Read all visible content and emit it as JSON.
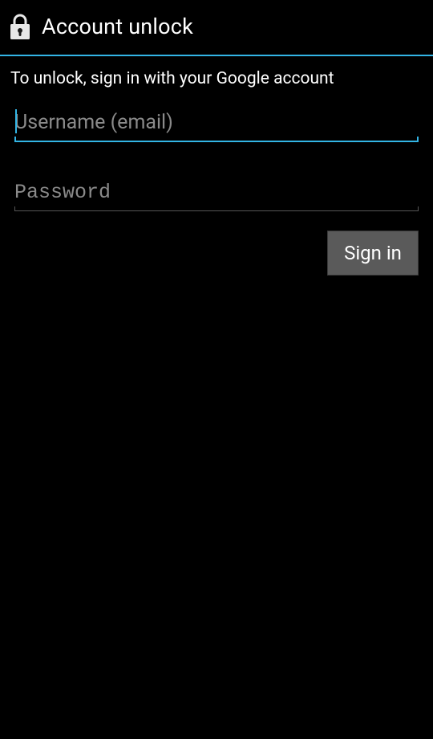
{
  "header": {
    "title": "Account unlock"
  },
  "content": {
    "instruction": "To unlock, sign in with your Google account",
    "username_placeholder": "Username (email)",
    "username_value": "",
    "password_placeholder": "Password",
    "password_value": "",
    "signin_label": "Sign in"
  },
  "colors": {
    "accent": "#33b5e5"
  }
}
